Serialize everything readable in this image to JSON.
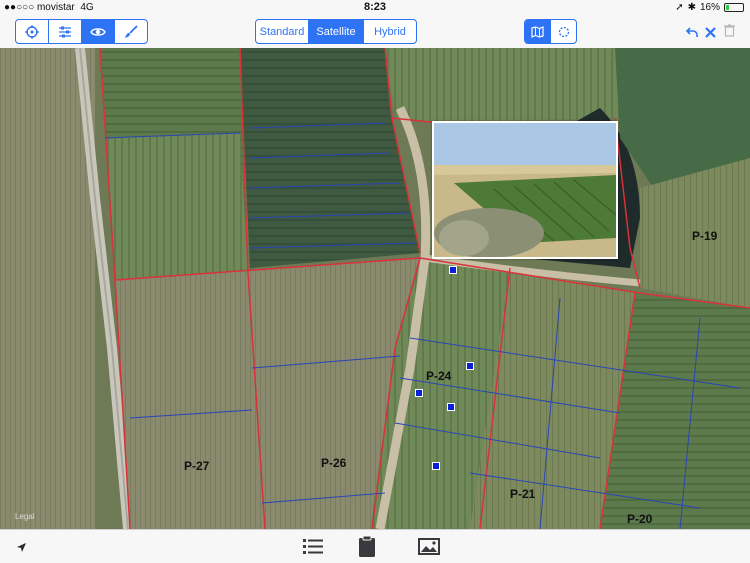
{
  "status_bar": {
    "carrier": "●●○○○ movistar",
    "network": "4G",
    "time": "8:23",
    "battery_percent": "16%",
    "battery_level": 0.16
  },
  "toolbar": {
    "left_tools": [
      {
        "icon": "target-icon"
      },
      {
        "icon": "sliders-icon"
      },
      {
        "icon": "eye-icon",
        "active": true
      },
      {
        "icon": "brush-icon"
      }
    ],
    "map_types": [
      {
        "label": "Standard",
        "active": false
      },
      {
        "label": "Satellite",
        "active": true
      },
      {
        "label": "Hybrid",
        "active": false
      }
    ],
    "right_segment": [
      {
        "icon": "map-icon",
        "active": true
      },
      {
        "icon": "circle-dashed-icon",
        "active": false
      }
    ],
    "actions": [
      {
        "icon": "undo-icon"
      },
      {
        "icon": "close-icon"
      },
      {
        "icon": "trash-icon"
      }
    ]
  },
  "map": {
    "parcels": [
      {
        "label": "P-19"
      },
      {
        "label": "P-24"
      },
      {
        "label": "P-27"
      },
      {
        "label": "P-26"
      },
      {
        "label": "P-21"
      },
      {
        "label": "P-20"
      }
    ],
    "legal_text": "Legal",
    "colors": {
      "parcel_border": "#d9323a",
      "row_lines": "#2845b8",
      "marker": "#0a1fd6"
    }
  },
  "bottom_bar": {
    "icons": [
      "location-arrow-icon",
      "list-icon",
      "clipboard-icon",
      "image-icon"
    ]
  }
}
